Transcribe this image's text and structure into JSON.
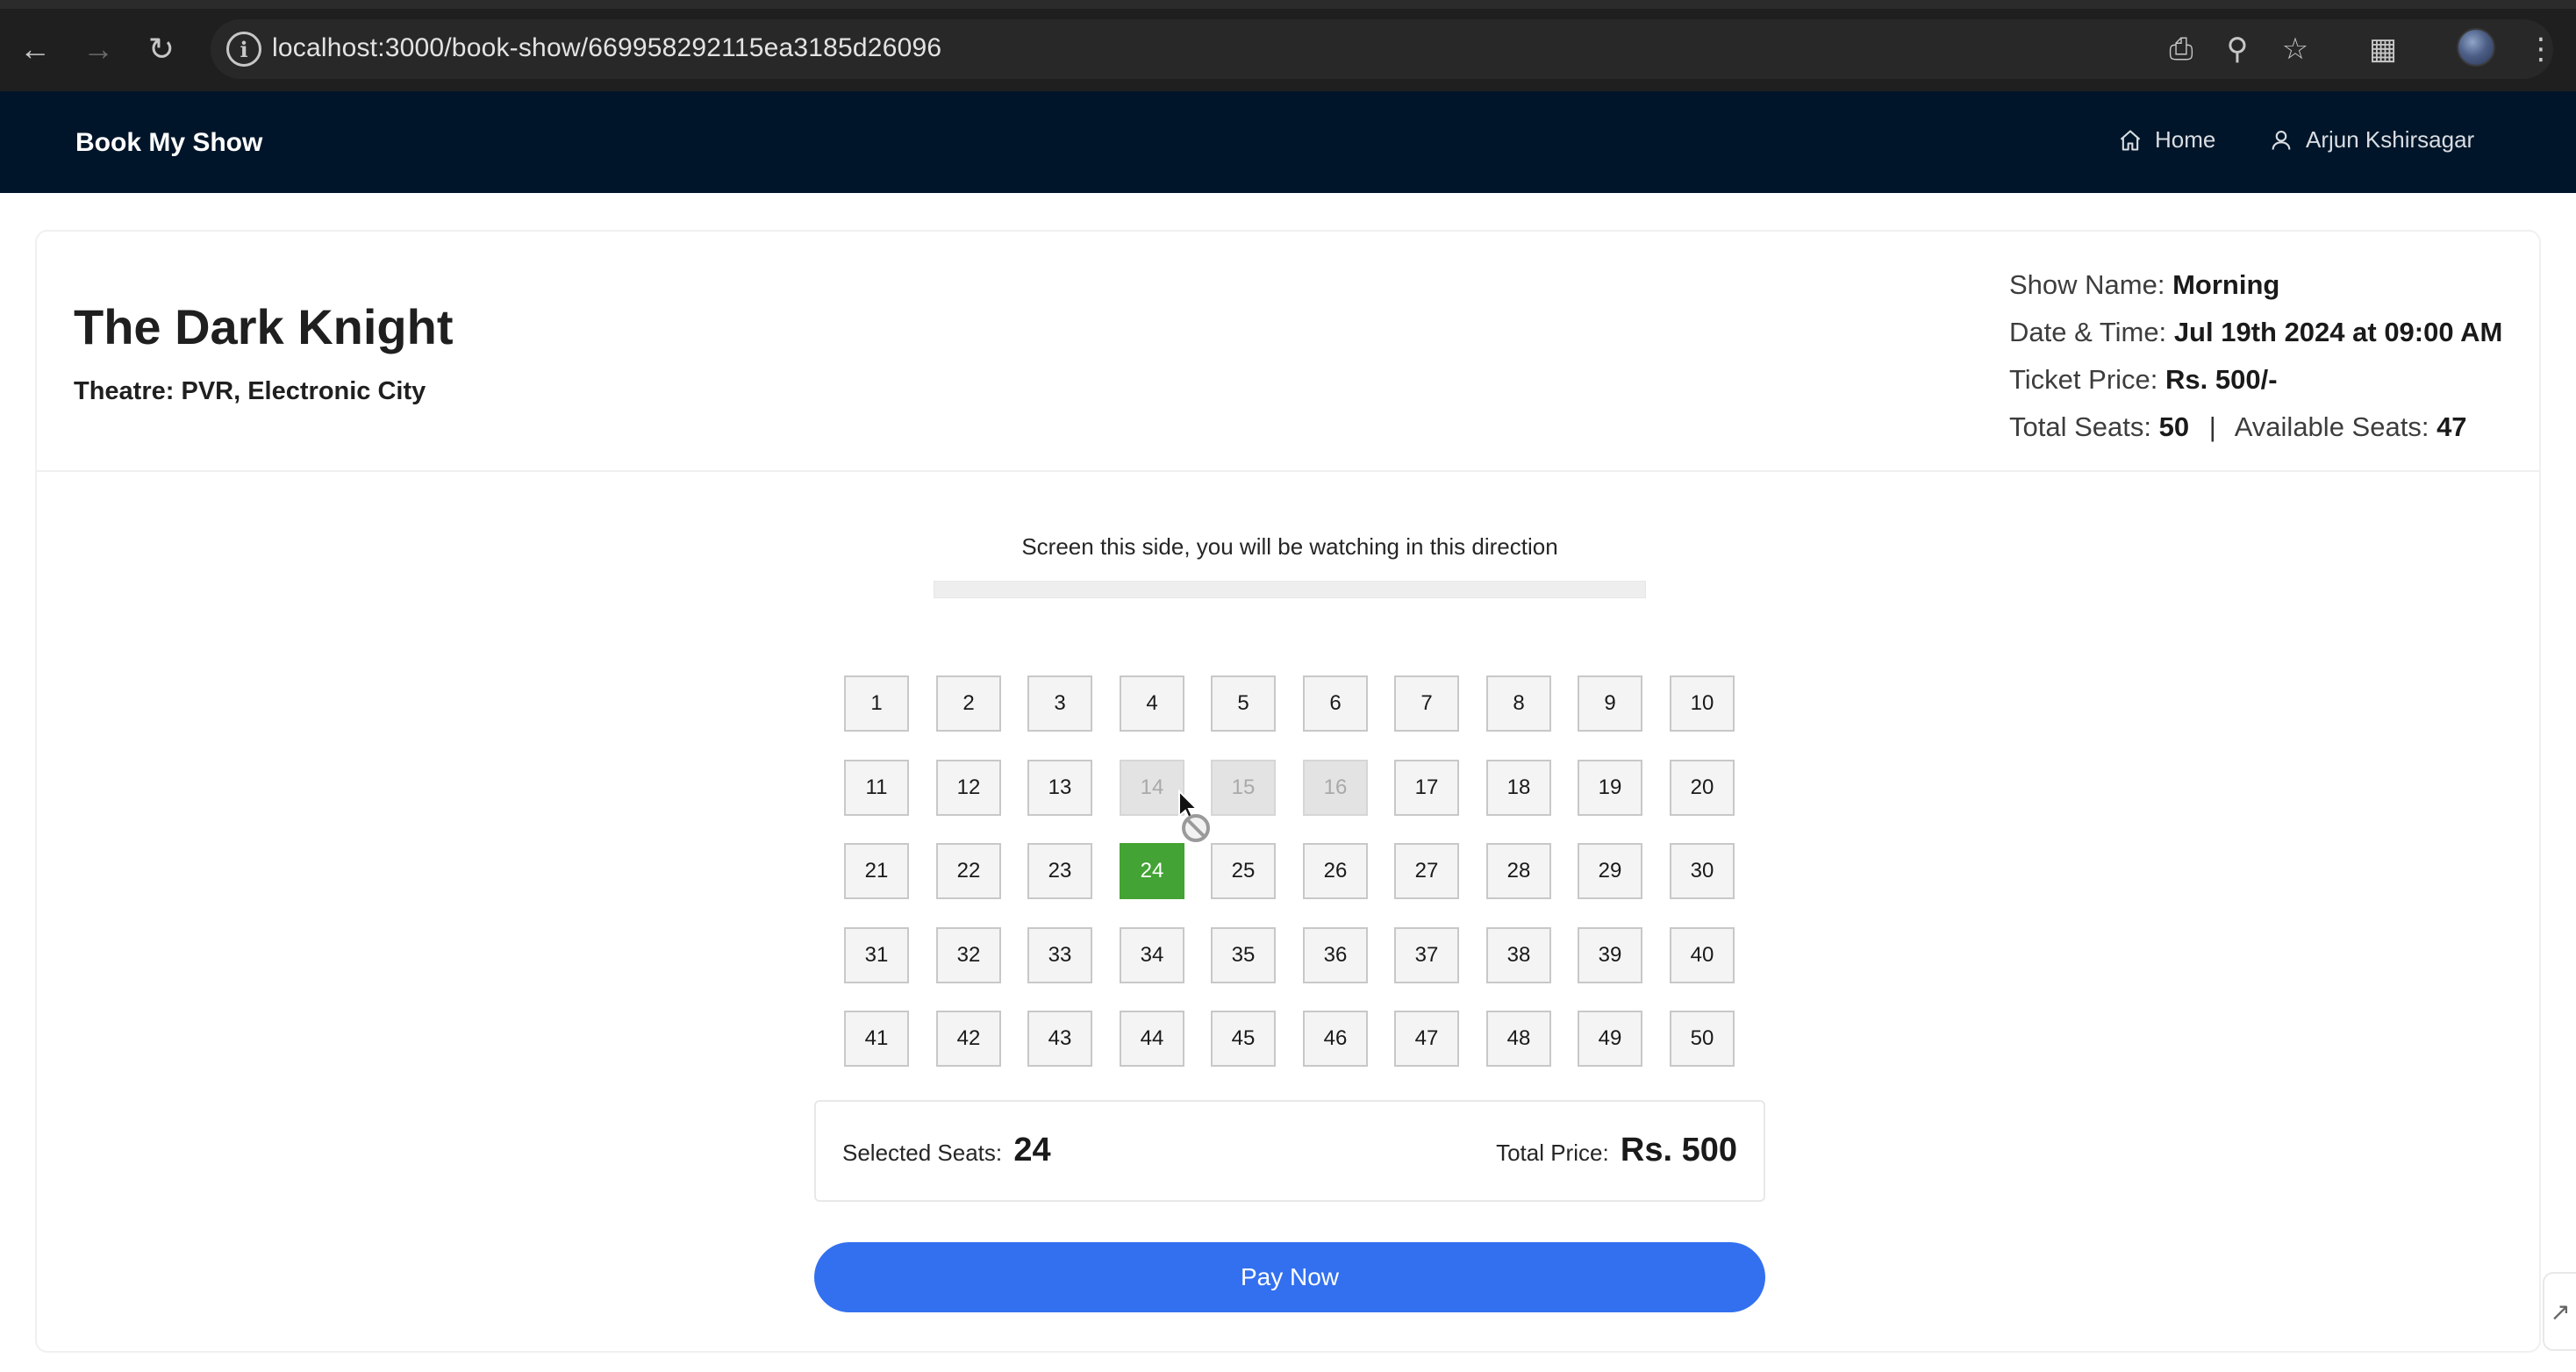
{
  "browser": {
    "url": "localhost:3000/book-show/669958292115ea3185d26096"
  },
  "header": {
    "brand": "Book My Show",
    "nav": [
      {
        "label": "Home",
        "icon": "home-icon"
      },
      {
        "label": "Arjun Kshirsagar",
        "icon": "user-icon"
      }
    ]
  },
  "movie": {
    "title": "The Dark Knight",
    "theatre": "Theatre: PVR, Electronic City"
  },
  "show": {
    "name_label": "Show Name:",
    "name": "Morning",
    "datetime_label": "Date & Time:",
    "datetime": "Jul 19th 2024 at 09:00 AM",
    "price_label": "Ticket Price:",
    "price": "Rs. 500/-",
    "total_label": "Total Seats:",
    "total": "50",
    "separator": "|",
    "available_label": "Available Seats:",
    "available": "47"
  },
  "screen": {
    "text": "Screen this side, you will be watching in this direction"
  },
  "seats": {
    "rows": 5,
    "per_row": 10,
    "booked": [
      14,
      15,
      16
    ],
    "selected": [
      24
    ]
  },
  "summary": {
    "selected_label": "Selected Seats:",
    "selected_value": "24",
    "total_label": "Total Price:",
    "total_value": "Rs. 500"
  },
  "pay_button": "Pay Now",
  "colors": {
    "header_bg": "#001529",
    "selected_seat": "#43a334",
    "booked_seat": "#e3e3e3",
    "pay_button": "#3370ef"
  }
}
